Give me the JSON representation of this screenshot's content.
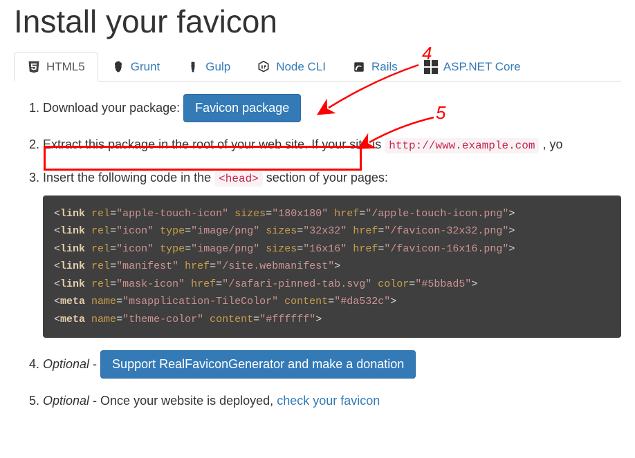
{
  "heading": "Install your favicon",
  "tabs": {
    "html5": "HTML5",
    "grunt": "Grunt",
    "gulp": "Gulp",
    "node": "Node CLI",
    "rails": "Rails",
    "aspnet": "ASP.NET Core"
  },
  "step1": {
    "text": "Download your package:",
    "button": "Favicon package"
  },
  "step2": {
    "part1": "Extract this package in the root of your web site.",
    "part2": " If your site is ",
    "example_url": "http://www.example.com",
    "part3": " , yo"
  },
  "step3": {
    "part1": "Insert the following code in the ",
    "head_tag": "<head>",
    "part2": " section of your pages:"
  },
  "code": {
    "l1": {
      "tag": "link",
      "a1": "rel",
      "v1": "apple-touch-icon",
      "a2": "sizes",
      "v2": "180x180",
      "a3": "href",
      "v3": "/apple-touch-icon.png"
    },
    "l2": {
      "tag": "link",
      "a1": "rel",
      "v1": "icon",
      "a2": "type",
      "v2": "image/png",
      "a3": "sizes",
      "v3": "32x32",
      "a4": "href",
      "v4": "/favicon-32x32.png"
    },
    "l3": {
      "tag": "link",
      "a1": "rel",
      "v1": "icon",
      "a2": "type",
      "v2": "image/png",
      "a3": "sizes",
      "v3": "16x16",
      "a4": "href",
      "v4": "/favicon-16x16.png"
    },
    "l4": {
      "tag": "link",
      "a1": "rel",
      "v1": "manifest",
      "a2": "href",
      "v2": "/site.webmanifest"
    },
    "l5": {
      "tag": "link",
      "a1": "rel",
      "v1": "mask-icon",
      "a2": "href",
      "v2": "/safari-pinned-tab.svg",
      "a3": "color",
      "v3": "#5bbad5"
    },
    "l6": {
      "tag": "meta",
      "a1": "name",
      "v1": "msapplication-TileColor",
      "a2": "content",
      "v2": "#da532c"
    },
    "l7": {
      "tag": "meta",
      "a1": "name",
      "v1": "theme-color",
      "a2": "content",
      "v2": "#ffffff"
    }
  },
  "step4": {
    "optional": "Optional",
    "dash": " - ",
    "button": "Support RealFaviconGenerator and make a donation"
  },
  "step5": {
    "optional": "Optional",
    "text": " - Once your website is deployed, ",
    "link": "check your favicon"
  },
  "annotations": {
    "n4": "4",
    "n5": "5"
  }
}
